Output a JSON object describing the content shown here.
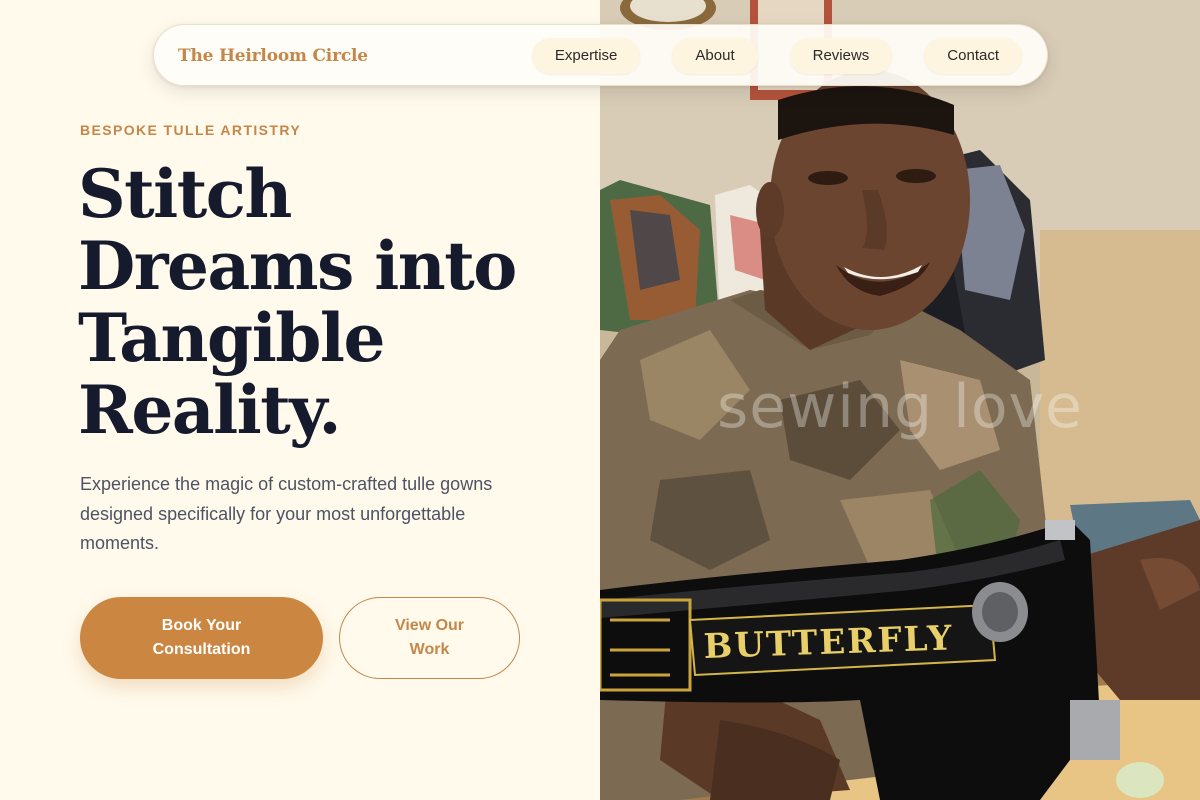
{
  "nav": {
    "brand": "The Heirloom Circle",
    "links": [
      "Expertise",
      "About",
      "Reviews",
      "Contact"
    ]
  },
  "hero": {
    "eyebrow": "BESPOKE TULLE ARTISTRY",
    "headline": "Stitch Dreams into Tangible Reality.",
    "subtext": "Experience the magic of custom-crafted tulle gowns designed specifically for your most unforgettable moments.",
    "primary_button": "Book Your Consultation",
    "secondary_button": "View Our Work"
  },
  "photo": {
    "watermark": "sewing love",
    "machine_brand": "BUTTERFLY"
  },
  "colors": {
    "accent": "#c4874a",
    "button": "#cb8641",
    "headline": "#151a2d",
    "background": "#fffaec"
  }
}
